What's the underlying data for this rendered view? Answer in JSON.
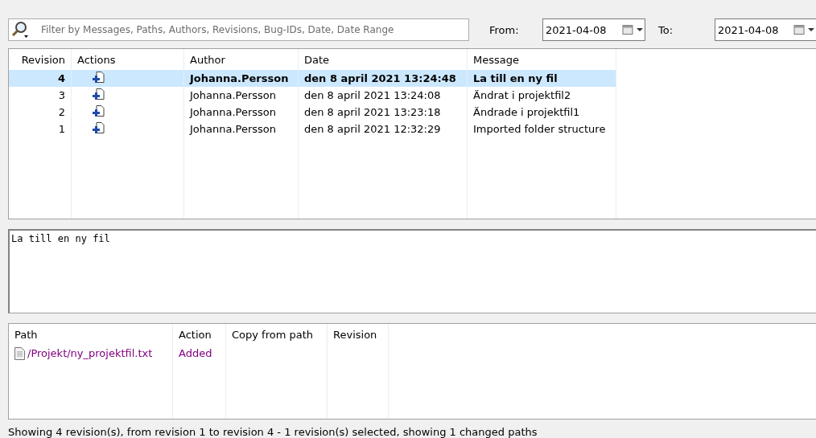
{
  "filter": {
    "placeholder": "Filter by Messages, Paths, Authors, Revisions, Bug-IDs, Date, Date Range"
  },
  "date_from": {
    "label": "From:",
    "value": "2021-04-08"
  },
  "date_to": {
    "label": "To:",
    "value": "2021-04-08"
  },
  "revisions": {
    "columns": [
      "Revision",
      "Actions",
      "Author",
      "Date",
      "Message"
    ],
    "rows": [
      {
        "revision": "4",
        "author": "Johanna.Persson",
        "date": "den 8 april 2021 13:24:48",
        "message": "La till en ny fil",
        "selected": true
      },
      {
        "revision": "3",
        "author": "Johanna.Persson",
        "date": "den 8 april 2021 13:24:08",
        "message": "Ändrat i projektfil2",
        "selected": false
      },
      {
        "revision": "2",
        "author": "Johanna.Persson",
        "date": "den 8 april 2021 13:23:18",
        "message": "Ändrade i projektfil1",
        "selected": false
      },
      {
        "revision": "1",
        "author": "Johanna.Persson",
        "date": "den 8 april 2021 12:32:29",
        "message": "Imported folder structure",
        "selected": false
      }
    ]
  },
  "log_message": "La till en ny fil",
  "paths": {
    "columns": [
      "Path",
      "Action",
      "Copy from path",
      "Revision"
    ],
    "rows": [
      {
        "path": "/Projekt/ny_projektfil.txt",
        "action": "Added"
      }
    ]
  },
  "status_bar": "Showing 4 revision(s), from revision 1 to revision 4 - 1 revision(s) selected, showing 1 changed paths"
}
